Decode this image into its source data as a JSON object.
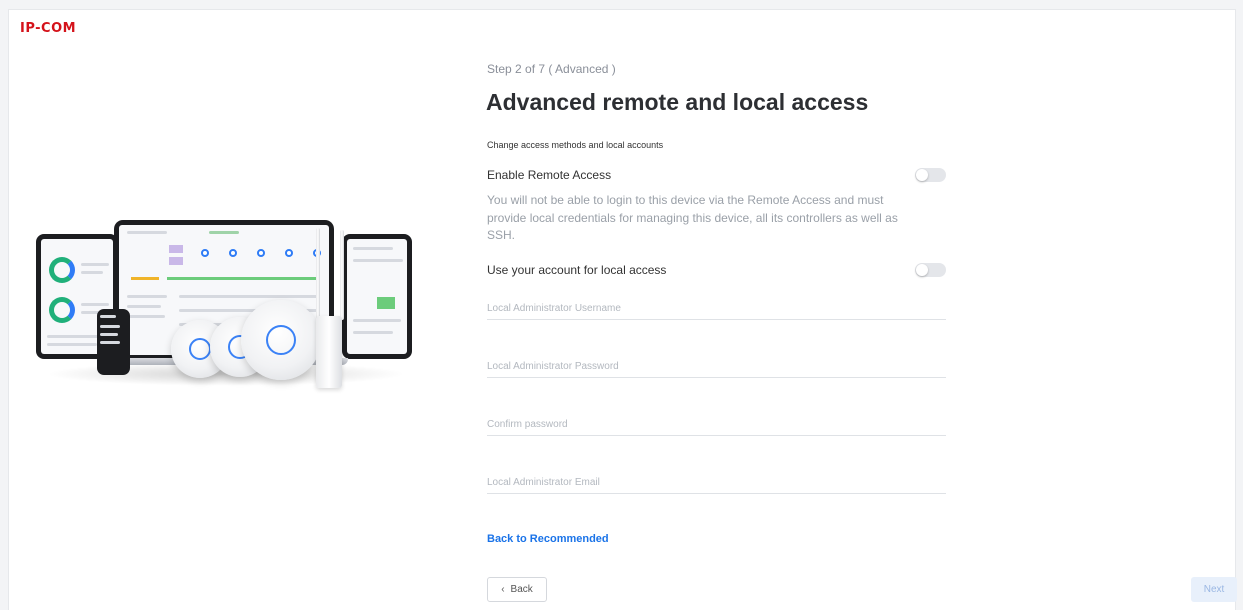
{
  "brand": {
    "logo_text": "IP-COM",
    "color": "#d4121a"
  },
  "wizard": {
    "step_text": "Step 2 of 7 ( Advanced )",
    "title": "Advanced remote and local access",
    "subtitle": "Change access methods and local accounts"
  },
  "remote_access": {
    "label": "Enable Remote Access",
    "enabled": false,
    "description": "You will not be able to login to this device via the Remote Access and must provide local credentials for managing this device, all its controllers as well as SSH."
  },
  "local_access": {
    "label": "Use your account for local access",
    "enabled": false
  },
  "fields": {
    "username": {
      "placeholder": "Local Administrator Username",
      "value": ""
    },
    "password": {
      "placeholder": "Local Administrator Password",
      "value": ""
    },
    "confirm": {
      "placeholder": "Confirm password",
      "value": ""
    },
    "email": {
      "placeholder": "Local Administrator Email",
      "value": ""
    }
  },
  "links": {
    "back_to_recommended": "Back to Recommended"
  },
  "buttons": {
    "back_icon": "chevron-left-icon",
    "back_glyph": "‹",
    "back": "Back",
    "next": "Next",
    "next_state": "disabled"
  },
  "colors": {
    "link": "#1a73e8",
    "toggle_off": "#e4e6ea",
    "next_disabled_bg": "#e8f0fb"
  },
  "illustration": {
    "description_icon": "product-lineup-illustration"
  }
}
